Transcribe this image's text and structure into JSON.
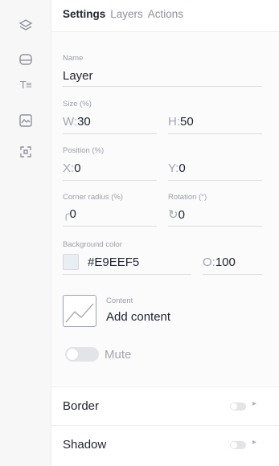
{
  "tabs": [
    {
      "label": "Settings"
    },
    {
      "label": "Layers"
    },
    {
      "label": "Actions"
    }
  ],
  "rail": {
    "icons": [
      "layers-icon",
      "shape-icon",
      "text-icon",
      "image-icon",
      "scan-icon"
    ],
    "text_icon_glyph": "T≡"
  },
  "fields": {
    "name": {
      "label": "Name",
      "value": "Layer"
    },
    "size": {
      "label": "Size (%)",
      "w_prefix": "W:",
      "w_value": "30",
      "h_prefix": "H:",
      "h_value": "50"
    },
    "position": {
      "label": "Position (%)",
      "x_prefix": "X:",
      "x_value": "0",
      "y_prefix": "Y:",
      "y_value": "0"
    },
    "corner_radius": {
      "label": "Corner radius (%)",
      "value": "0"
    },
    "rotation": {
      "label": "Rotation (°)",
      "value": "0"
    },
    "background": {
      "label": "Background color",
      "value": "#E9EEF5",
      "opacity_prefix": "O:",
      "opacity_value": "100"
    }
  },
  "content": {
    "label": "Content",
    "action": "Add content"
  },
  "mute": {
    "label": "Mute",
    "on": false
  },
  "rows": [
    {
      "label": "Border",
      "on": false
    },
    {
      "label": "Shadow",
      "on": false
    }
  ],
  "colors": {
    "background_swatch": "#E9EEF5"
  }
}
